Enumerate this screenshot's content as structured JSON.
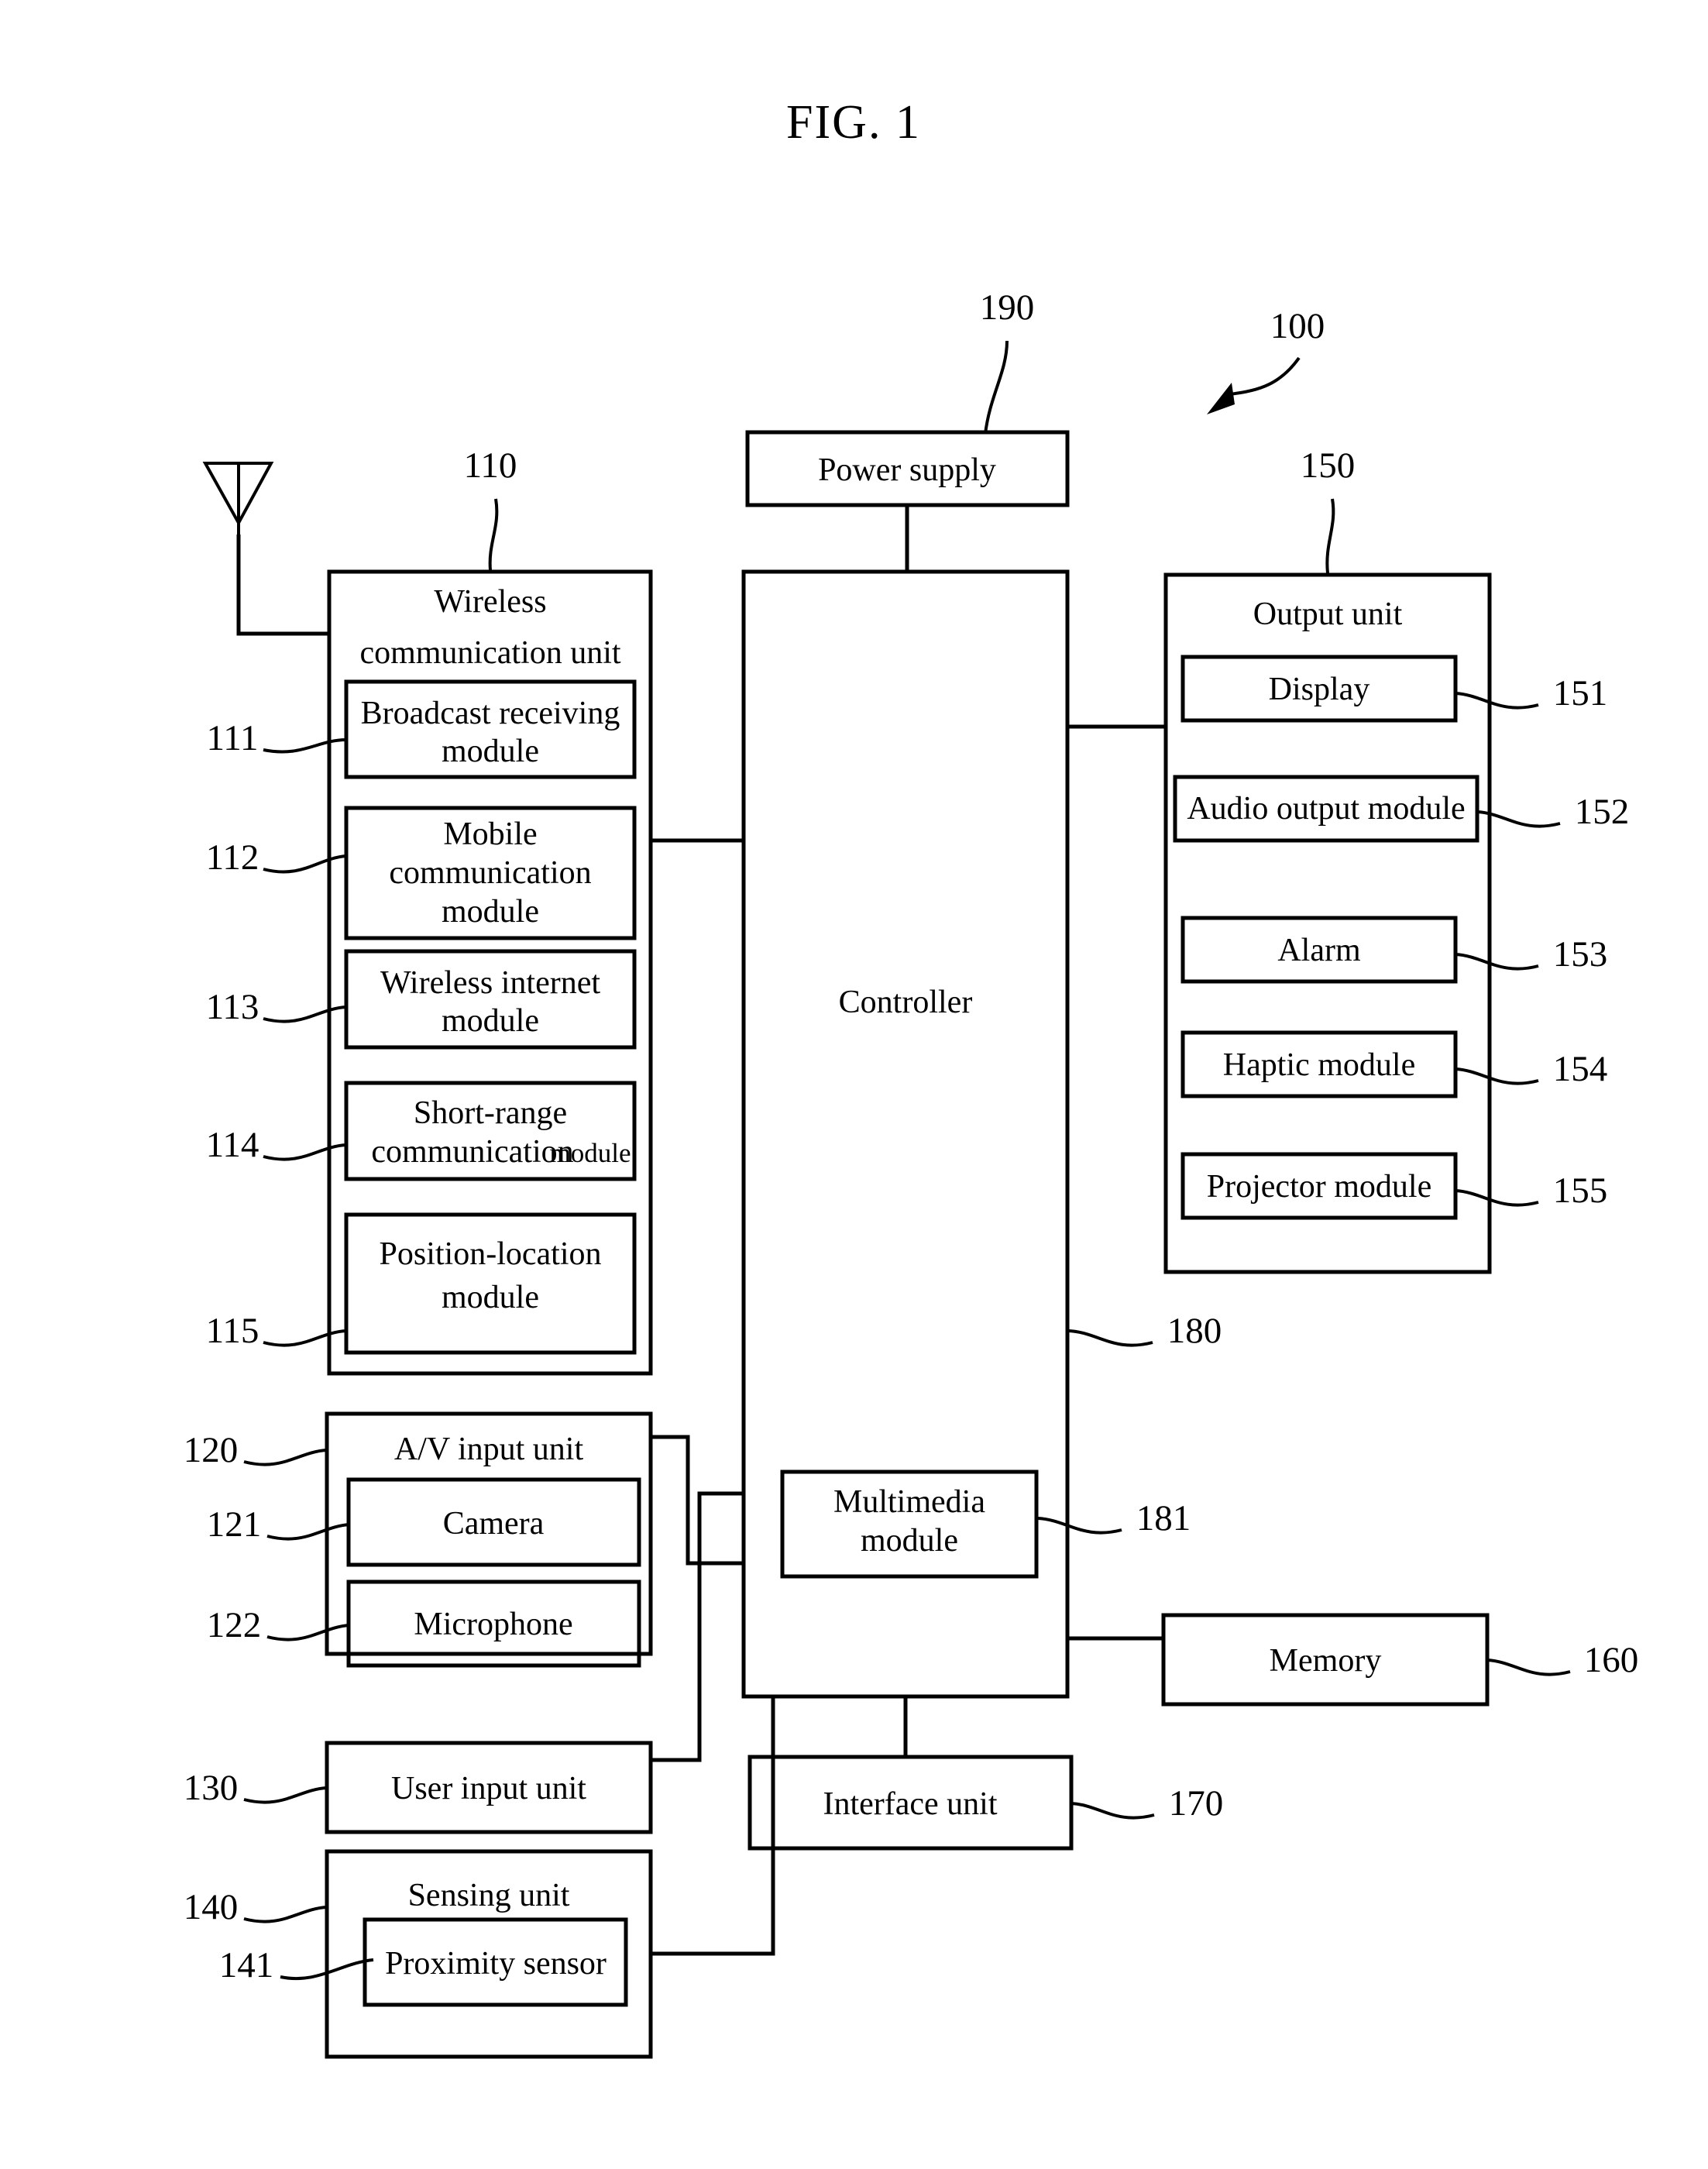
{
  "figure": {
    "title": "FIG. 1"
  },
  "blocks": {
    "power_supply": {
      "label": "Power supply",
      "ref": "190"
    },
    "device": {
      "ref": "100"
    },
    "wireless_communication_unit": {
      "label_line1": "Wireless",
      "label_line2": "communication unit",
      "ref": "110",
      "modules": [
        {
          "label_line1": "Broadcast receiving",
          "label_line2": "module",
          "ref": "111"
        },
        {
          "label_line1": "Mobile",
          "label_line2": "communication",
          "label_line3": "module",
          "ref": "112"
        },
        {
          "label_line1": "Wireless internet",
          "label_line2": "module",
          "ref": "113"
        },
        {
          "label_line1": "Short-range",
          "label_line2": "communication",
          "label_line2b": "module",
          "ref": "114"
        },
        {
          "label_line1": "Position-location",
          "label_line2": "module",
          "ref": "115"
        }
      ]
    },
    "av_input_unit": {
      "label": "A/V input unit",
      "ref": "120",
      "modules": [
        {
          "label": "Camera",
          "ref": "121"
        },
        {
          "label": "Microphone",
          "ref": "122"
        }
      ]
    },
    "user_input_unit": {
      "label": "User input unit",
      "ref": "130"
    },
    "sensing_unit": {
      "label": "Sensing unit",
      "ref": "140",
      "modules": [
        {
          "label": "Proximity sensor",
          "ref": "141"
        }
      ]
    },
    "controller": {
      "label": "Controller",
      "ref": "180",
      "modules": [
        {
          "label_line1": "Multimedia",
          "label_line2": "module",
          "ref": "181"
        }
      ]
    },
    "output_unit": {
      "label": "Output unit",
      "ref": "150",
      "modules": [
        {
          "label": "Display",
          "ref": "151"
        },
        {
          "label": "Audio output module",
          "ref": "152"
        },
        {
          "label": "Alarm",
          "ref": "153"
        },
        {
          "label": "Haptic module",
          "ref": "154"
        },
        {
          "label": "Projector module",
          "ref": "155"
        }
      ]
    },
    "memory": {
      "label": "Memory",
      "ref": "160"
    },
    "interface_unit": {
      "label": "Interface unit",
      "ref": "170"
    }
  },
  "icons": {
    "antenna": "antenna-icon",
    "pointer_arrow": "pointer-arrow-icon"
  },
  "colors": {
    "ink": "#000000",
    "paper": "#ffffff"
  }
}
